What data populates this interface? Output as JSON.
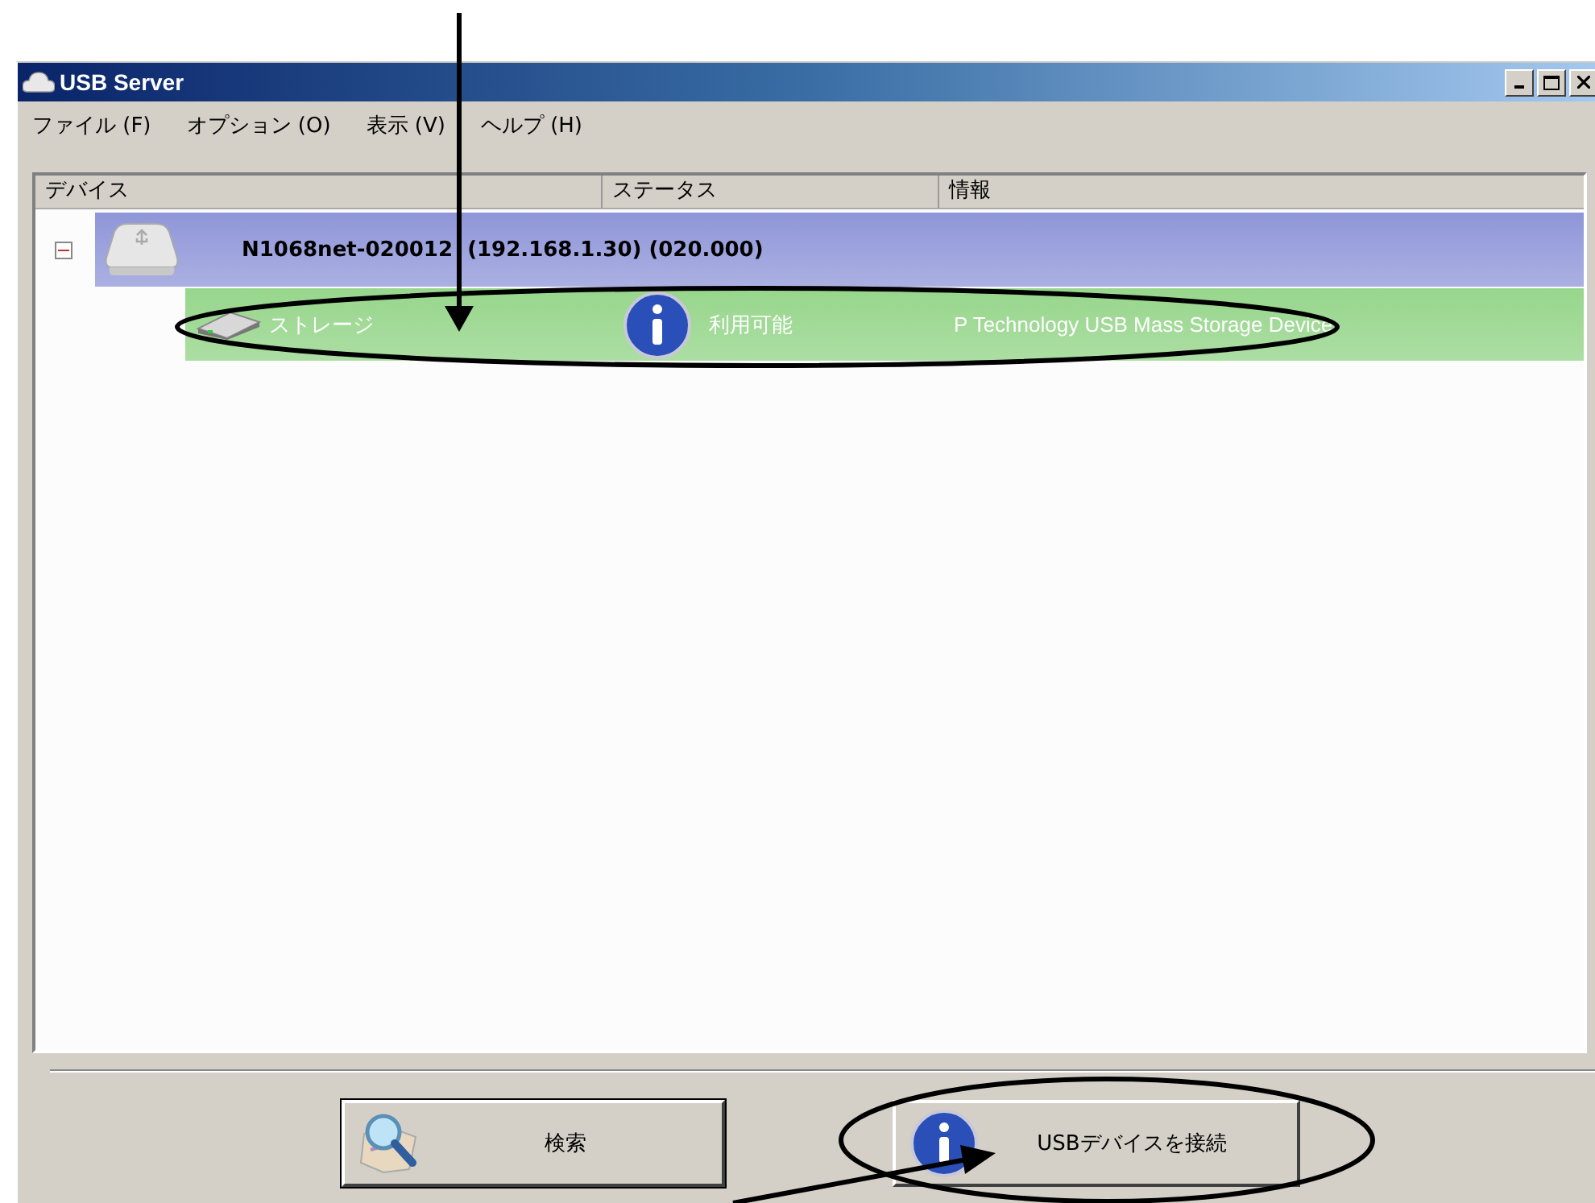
{
  "window": {
    "title": "USB Server"
  },
  "menu": [
    {
      "label": "ファイル (F)"
    },
    {
      "label": "オプション (O)"
    },
    {
      "label": "表示 (V)"
    },
    {
      "label": "ヘルプ (H)"
    }
  ],
  "tree": {
    "columns": [
      "デバイス",
      "ステータス",
      "情報"
    ],
    "nodes": [
      {
        "name": "N1068net-020012  (192.168.1.30) (020.000)",
        "color": "#8f96d8",
        "expanded": true,
        "children": [
          {
            "name": "ストレージ",
            "status": "利用可能",
            "info": "P Technology USB Mass Storage Device",
            "color": "#97d68c"
          }
        ]
      }
    ]
  },
  "buttons": [
    {
      "label": "検索",
      "kind": "search"
    },
    {
      "label": "USBデバイスを接続",
      "kind": "connect"
    }
  ]
}
